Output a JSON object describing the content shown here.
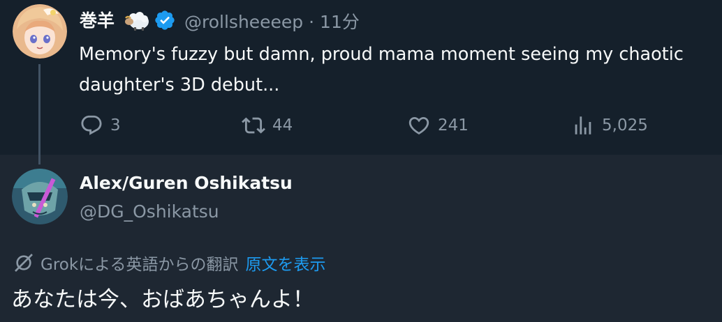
{
  "parent_tweet": {
    "display_name": "巻羊",
    "handle": "@rollsheeeep",
    "separator": "·",
    "time": "11分",
    "text": "Memory's fuzzy but damn, proud mama moment seeing my chaotic daughter's 3D debut...",
    "actions": {
      "reply_count": "3",
      "retweet_count": "44",
      "like_count": "241",
      "view_count": "5,025"
    },
    "icons": [
      "sheep-emoji-icon",
      "verified-badge-icon",
      "reply-icon",
      "retweet-icon",
      "like-icon",
      "views-icon"
    ]
  },
  "reply_tweet": {
    "display_name": "Alex/Guren Oshikatsu",
    "handle": "@DG_Oshikatsu",
    "translation_label": "Grokによる英語からの翻訳",
    "show_original_label": "原文を表示",
    "text": "あなたは今、おばあちゃんよ！",
    "icons": [
      "grok-icon"
    ]
  },
  "colors": {
    "background_top": "#15202b",
    "background_reply": "#1e2732",
    "text_primary": "#f7f9f9",
    "text_secondary": "#8b98a5",
    "accent_blue": "#1d9bf0"
  }
}
